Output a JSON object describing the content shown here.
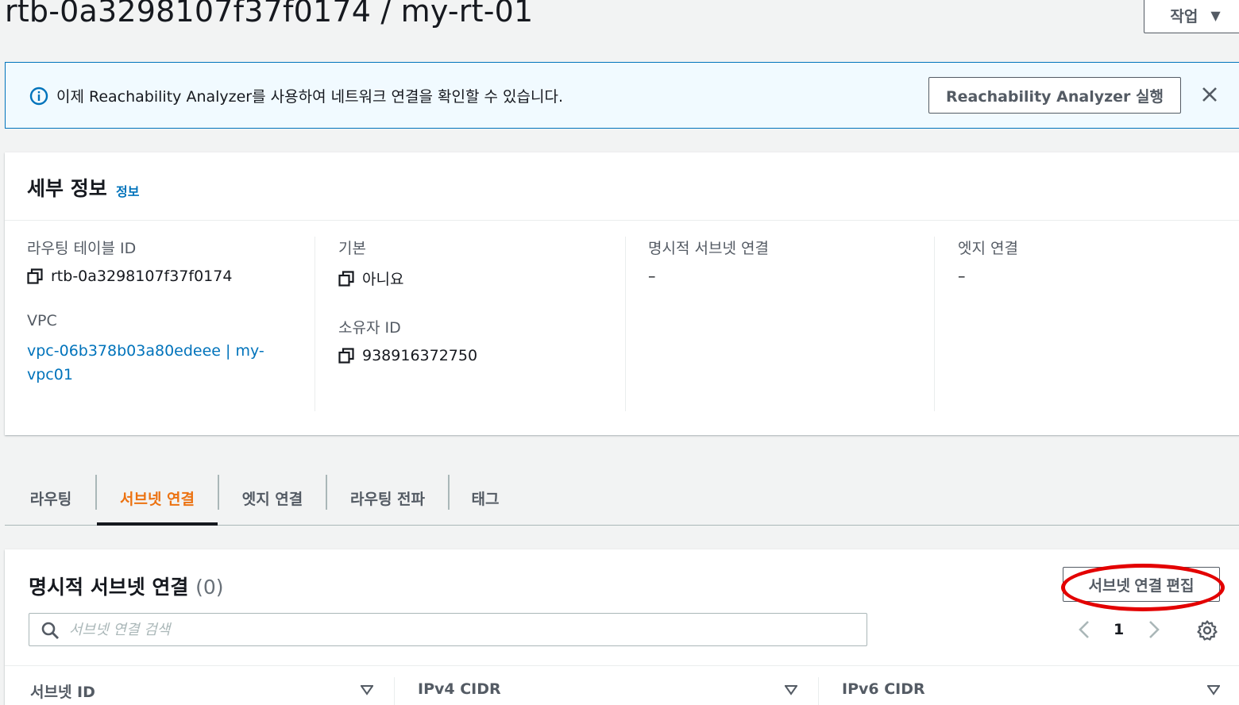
{
  "header": {
    "title": "rtb-0a3298107f37f0174 / my-rt-01",
    "actions_label": "작업"
  },
  "flash": {
    "message": "이제 Reachability Analyzer를 사용하여 네트워크 연결을 확인할 수 있습니다.",
    "button_label": "Reachability Analyzer 실행",
    "icon": "info-icon",
    "accent": "#0073bb"
  },
  "details": {
    "title": "세부 정보",
    "info_link": "정보",
    "route_table_id_label": "라우팅 테이블 ID",
    "route_table_id_value": "rtb-0a3298107f37f0174",
    "vpc_label": "VPC",
    "vpc_value": "vpc-06b378b03a80edeee | my-vpc01",
    "main_label": "기본",
    "main_value": "아니요",
    "owner_id_label": "소유자 ID",
    "owner_id_value": "938916372750",
    "explicit_subnet_label": "명시적 서브넷 연결",
    "explicit_subnet_value": "–",
    "edge_label": "엣지 연결",
    "edge_value": "–"
  },
  "tabs": [
    {
      "label": "라우팅",
      "active": false
    },
    {
      "label": "서브넷 연결",
      "active": true
    },
    {
      "label": "엣지 연결",
      "active": false
    },
    {
      "label": "라우팅 전파",
      "active": false
    },
    {
      "label": "태그",
      "active": false
    }
  ],
  "subnet_table": {
    "title": "명시적 서브넷 연결",
    "count": "(0)",
    "edit_button": "서브넷 연결 편집",
    "search_placeholder": "서브넷 연결 검색",
    "page_number": "1",
    "columns": [
      "서브넷 ID",
      "IPv4 CIDR",
      "IPv6 CIDR"
    ]
  },
  "colors": {
    "active_tab": "#ec7211",
    "link": "#0073bb",
    "highlight_ring": "#e30000"
  }
}
